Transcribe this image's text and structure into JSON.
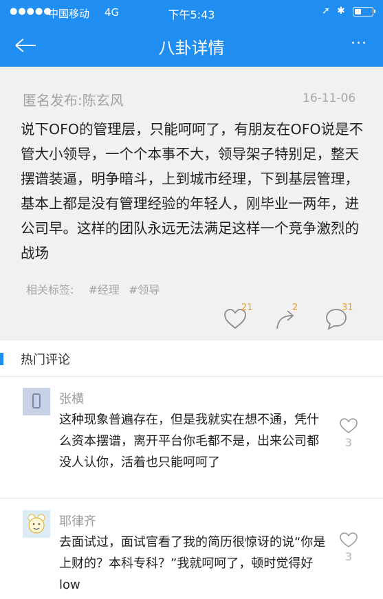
{
  "status_bar": {
    "signal": "●●●●●",
    "carrier": "中国移动",
    "network": "4G",
    "time": "下午5:43"
  },
  "nav": {
    "title": "八卦详情",
    "more": "···"
  },
  "post": {
    "author": "匿名发布:陈玄风",
    "date": "16-11-06",
    "content": "说下OFO的管理层，只能呵呵了，有朋友在OFO说是不管大小领导，一个个本事不大，领导架子特别足，整天摆谱装逼，明争暗斗，上到城市经理，下到基层管理，基本上都是没有管理经验的年轻人，刚毕业一两年，进公司早。这样的团队永远无法满足这样一个竞争激烈的战场",
    "tags_label": "相关标签:",
    "tags": [
      "#经理",
      "#领导"
    ],
    "like_count": "21",
    "share_count": "2",
    "comment_count": "31"
  },
  "hot_comments": {
    "label": "热门评论",
    "items": [
      {
        "name": "张横",
        "text": "这种现象普遍存在，但是我就实在想不通，凭什么资本摆谱，离开平台你毛都不是，出来公司都没人认你，活着也只能呵呵了",
        "likes": "3"
      },
      {
        "name": "耶律齐",
        "text": "去面试过，面试官看了我的简历很惊讶的说“你是上财的？本科专科？”我就呵呵了，顿时觉得好low",
        "likes": "3"
      }
    ]
  },
  "colors": {
    "brand_blue": "#1f8ef0",
    "count_orange": "#f0a024",
    "card_gray": "#f1f1f1"
  },
  "battery_level": 0.4
}
